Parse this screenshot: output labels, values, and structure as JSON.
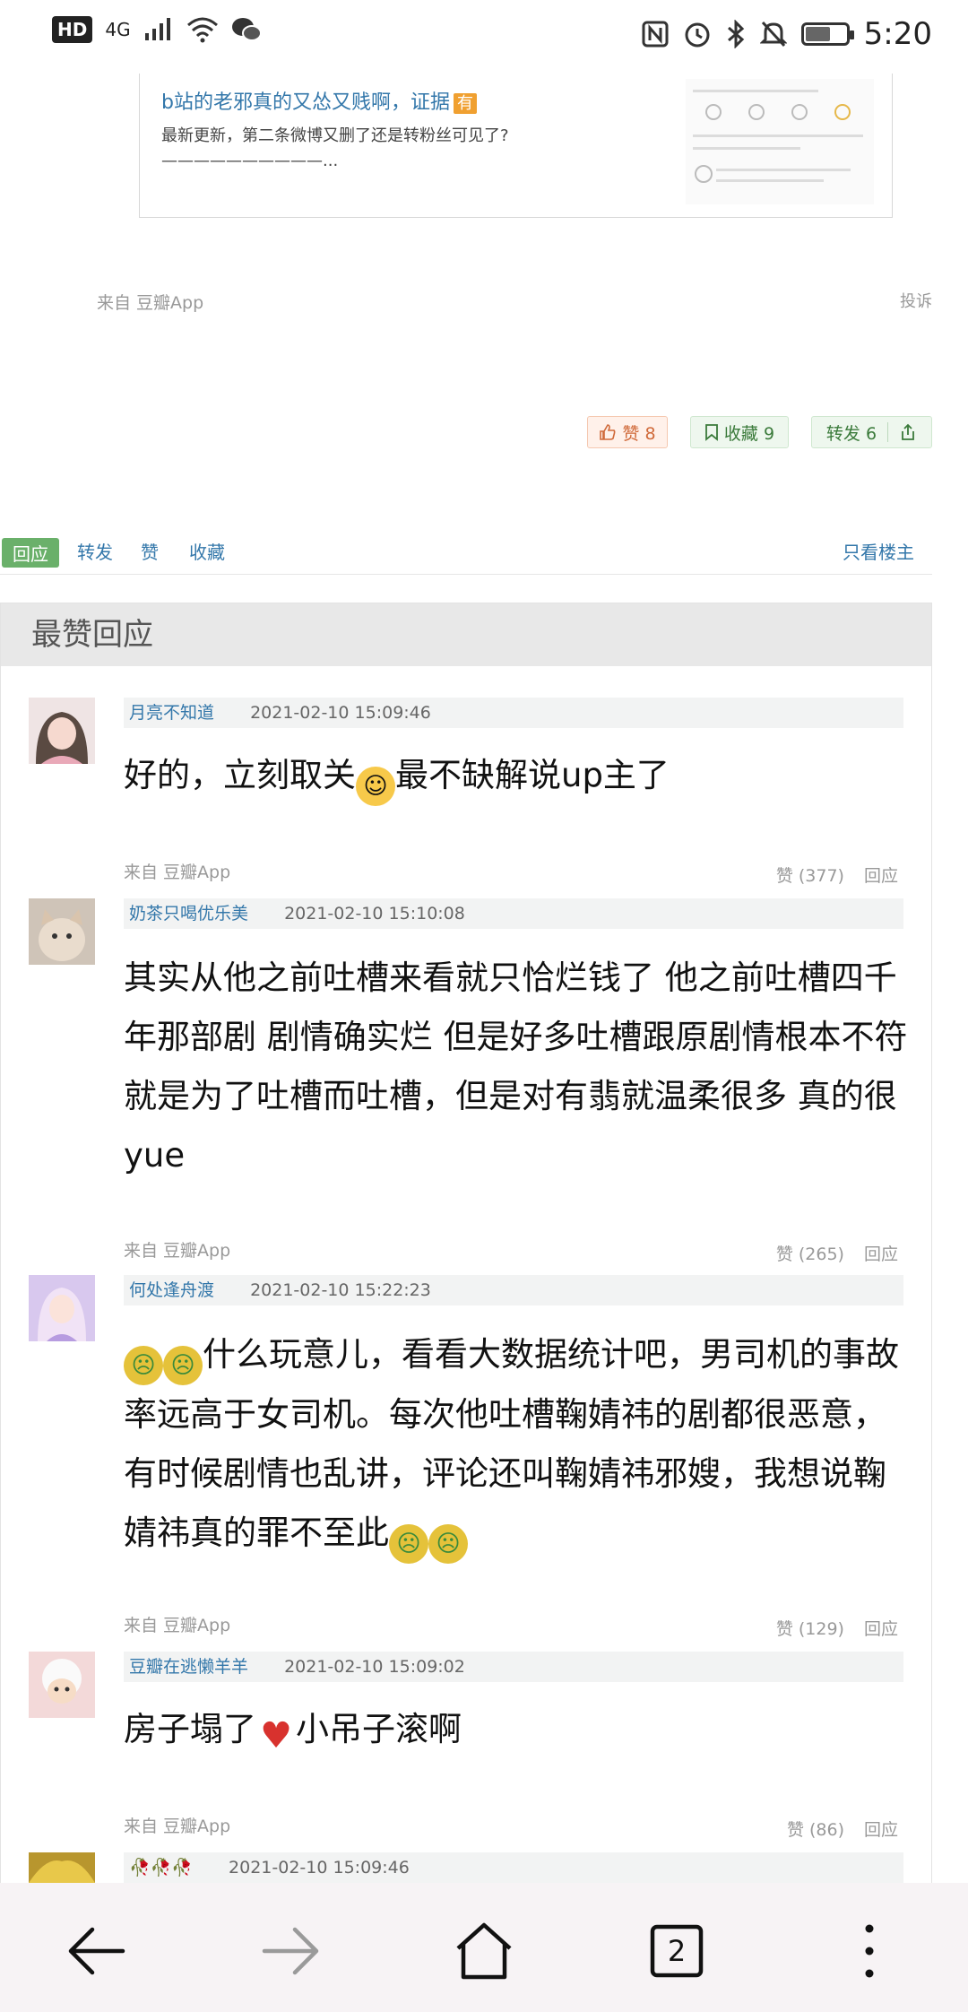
{
  "status_bar": {
    "hd": "HD",
    "network": "4G",
    "time": "5:20",
    "icons": [
      "signal-icon",
      "wifi-icon",
      "wechat-icon",
      "nfc-icon",
      "alarm-icon",
      "bluetooth-icon",
      "mute-icon",
      "battery-icon"
    ]
  },
  "link_card": {
    "title": "b站的老邪真的又怂又贱啊，证据",
    "tag": "有",
    "description": "最新更新，第二条微博又删了还是转粉丝可见了?——————————..."
  },
  "post": {
    "source": "来自 豆瓣App",
    "report": "投诉",
    "like_label": "赞 8",
    "collect_label": "收藏 9",
    "share_label": "转发 6"
  },
  "tabs": {
    "reply": "回应",
    "forward": "转发",
    "like": "赞",
    "collect": "收藏",
    "only_op": "只看楼主"
  },
  "best_replies": {
    "heading": "最赞回应",
    "comments": [
      {
        "name": "月亮不知道",
        "time": "2021-02-10 15:09:46",
        "text_a": "好的，立刻取关",
        "text_b": "最不缺解说up主了",
        "source": "来自 豆瓣App",
        "likes": "赞 (377)",
        "reply": "回应"
      },
      {
        "name": "奶茶只喝优乐美",
        "time": "2021-02-10 15:10:08",
        "text": "其实从他之前吐槽来看就只恰烂钱了 他之前吐槽四千年那部剧 剧情确实烂 但是好多吐槽跟原剧情根本不符 就是为了吐槽而吐槽，但是对有翡就温柔很多 真的很yue",
        "source": "来自 豆瓣App",
        "likes": "赞 (265)",
        "reply": "回应"
      },
      {
        "name": "何处逢舟渡",
        "time": "2021-02-10 15:22:23",
        "text": "什么玩意儿，看看大数据统计吧，男司机的事故率远高于女司机。每次他吐槽鞠婧祎的剧都很恶意，有时候剧情也乱讲，评论还叫鞠婧祎邪嫂，我想说鞠婧祎真的罪不至此",
        "source": "来自 豆瓣App",
        "likes": "赞 (129)",
        "reply": "回应"
      },
      {
        "name": "豆瓣在逃懒羊羊",
        "time": "2021-02-10 15:09:02",
        "text_a": "房子塌了",
        "text_b": "小吊子滚啊",
        "source": "来自 豆瓣App",
        "likes": "赞 (86)",
        "reply": "回应"
      },
      {
        "name": "🥀🥀🥀",
        "time": "2021-02-10 15:09:46"
      }
    ]
  },
  "bottom_nav": {
    "tab_count": "2",
    "icons": [
      "back-arrow-icon",
      "forward-arrow-icon",
      "home-icon",
      "tabs-icon",
      "more-icon"
    ]
  },
  "colors": {
    "link_blue": "#3377aa",
    "active_tab_green": "#6ab06a",
    "like_orange": "#d06a3a",
    "meta_gray": "#999999"
  }
}
